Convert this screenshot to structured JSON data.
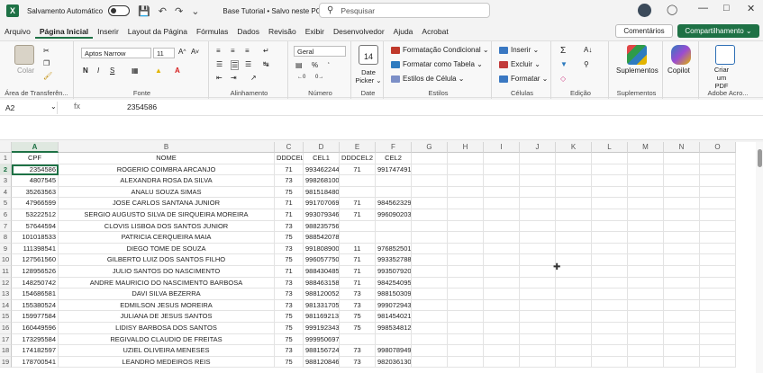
{
  "titlebar": {
    "autosave_label": "Salvamento Automático",
    "doc_title": "Base Tutorial • Salvo neste PC ⌄",
    "search_placeholder": "Pesquisar"
  },
  "tabs": [
    "Arquivo",
    "Página Inicial",
    "Inserir",
    "Layout da Página",
    "Fórmulas",
    "Dados",
    "Revisão",
    "Exibir",
    "Desenvolvedor",
    "Ajuda",
    "Acrobat"
  ],
  "active_tab": "Página Inicial",
  "buttons": {
    "comments": "Comentários",
    "share": "Compartilhamento ⌄"
  },
  "ribbon": {
    "clipboard": {
      "label": "Área de Transferên...",
      "paste": "Colar"
    },
    "font": {
      "label": "Fonte",
      "name": "Aptos Narrow",
      "size": "11"
    },
    "alignment": {
      "label": "Alinhamento"
    },
    "number": {
      "label": "Número",
      "format": "Geral",
      "pct": "%"
    },
    "date": {
      "label": "Date",
      "picker": "Date Picker ⌄",
      "day": "14"
    },
    "styles": {
      "label": "Estilos",
      "items": [
        "Formatação Condicional ⌄",
        "Formatar como Tabela ⌄",
        "Estilos de Célula ⌄"
      ]
    },
    "cells": {
      "label": "Células",
      "items": [
        "Inserir ⌄",
        "Excluir ⌄",
        "Formatar ⌄"
      ]
    },
    "editing": {
      "label": "Edição"
    },
    "addins": {
      "label": "Suplementos",
      "button": "Suplementos"
    },
    "copilot": {
      "button": "Copilot"
    },
    "adobe": {
      "label": "Adobe Acro...",
      "button": "Criar um PDF"
    }
  },
  "formula_bar": {
    "cell_ref": "A2",
    "fx": "fx",
    "value": "2354586"
  },
  "colors": {
    "accent": "#1e7145",
    "selected_header": "#dfe8e0"
  },
  "columns": [
    "A",
    "B",
    "C",
    "D",
    "E",
    "F",
    "G",
    "H",
    "I",
    "J",
    "K",
    "L",
    "M",
    "N",
    "O"
  ],
  "rows": [
    [
      "CPF",
      "NOME",
      "DDDCEL1",
      "CEL1",
      "DDDCEL2",
      "CEL2"
    ],
    [
      "2354586",
      "ROGERIO COIMBRA ARCANJO",
      "71",
      "993462244",
      "71",
      "991747491"
    ],
    [
      "4807545",
      "ALEXANDRA ROSA DA SILVA",
      "73",
      "998268100",
      "",
      ""
    ],
    [
      "35263563",
      "ANALU SOUZA SIMAS",
      "75",
      "981518480",
      "",
      ""
    ],
    [
      "47966599",
      "JOSE CARLOS SANTANA JUNIOR",
      "71",
      "991707069",
      "71",
      "984562329"
    ],
    [
      "53222512",
      "SERGIO AUGUSTO SILVA DE SIRQUEIRA MOREIRA",
      "71",
      "993079346",
      "71",
      "996090203"
    ],
    [
      "57644594",
      "CLOVIS LISBOA DOS SANTOS JUNIOR",
      "73",
      "988235756",
      "",
      ""
    ],
    [
      "101018533",
      "PATRICIA CERQUEIRA MAIA",
      "75",
      "988542078",
      "",
      ""
    ],
    [
      "111398541",
      "DIEGO TOME DE SOUZA",
      "73",
      "991808900",
      "11",
      "976852501"
    ],
    [
      "127561560",
      "GILBERTO LUIZ DOS SANTOS FILHO",
      "75",
      "996057750",
      "71",
      "993352788"
    ],
    [
      "128956526",
      "JULIO SANTOS DO NASCIMENTO",
      "71",
      "988430485",
      "71",
      "993507920"
    ],
    [
      "148250742",
      "ANDRE MAURICIO DO NASCIMENTO BARBOSA",
      "73",
      "988463158",
      "71",
      "984254095"
    ],
    [
      "154686581",
      "DAVI SILVA BEZERRA",
      "73",
      "988120052",
      "73",
      "988150309"
    ],
    [
      "155380524",
      "EDMILSON JESUS MOREIRA",
      "73",
      "981331705",
      "73",
      "999072943"
    ],
    [
      "159977584",
      "JULIANA DE JESUS SANTOS",
      "75",
      "981169213",
      "75",
      "981454021"
    ],
    [
      "160449596",
      "LIDISY BARBOSA DOS SANTOS",
      "75",
      "999192343",
      "75",
      "998534812"
    ],
    [
      "173295584",
      "REGIVALDO CLAUDIO DE FREITAS",
      "75",
      "999950697",
      "",
      ""
    ],
    [
      "174182597",
      "UZIEL OLIVEIRA MENESES",
      "73",
      "988156724",
      "73",
      "998078949"
    ],
    [
      "178700541",
      "LEANDRO MEDEIROS REIS",
      "75",
      "988120846",
      "73",
      "982036130"
    ]
  ]
}
